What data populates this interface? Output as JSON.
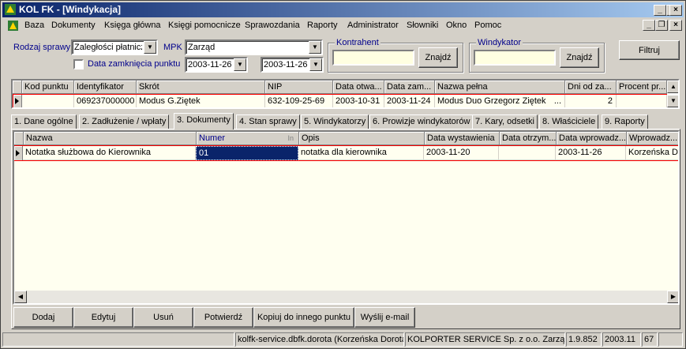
{
  "window": {
    "title": "KOL FK - [Windykacja]",
    "controls": {
      "minimize": "_",
      "maximize": "□",
      "close": "×"
    }
  },
  "menu": {
    "items": [
      "Baza",
      "Dokumenty",
      "Księga główna",
      "Księgi pomocnicze",
      "Sprawozdania",
      "Raporty",
      "Administrator",
      "Słowniki",
      "Okno",
      "Pomoc"
    ],
    "controls": {
      "minimize": "_",
      "restore": "❐",
      "close": "×"
    }
  },
  "filters": {
    "rodzaj_label": "Rodzaj sprawy",
    "rodzaj_value": "Zaległości płatnicz",
    "mpk_label": "MPK",
    "mpk_value": "Zarząd",
    "data_zamkniecia_label": "Data zamknięcia punktu",
    "date_from": "2003-11-26",
    "date_to": "2003-11-26",
    "kontrahent_title": "Kontrahent",
    "kontrahent_button": "Znajdź",
    "windykator_title": "Windykator",
    "windykator_button": "Znajdź",
    "filter_button": "Filtruj"
  },
  "main_table": {
    "columns": [
      "Kod punktu",
      "Identyfikator",
      "Skrót",
      "NIP",
      "Data otwa...",
      "Data zam...",
      "Nazwa pełna",
      "Dni od za...",
      "Procent pr..."
    ],
    "rows": [
      [
        "",
        "069237000000",
        "Modus G.Ziętek",
        "632-109-25-69",
        "2003-10-31",
        "2003-11-24",
        "Modus Duo Grzegorz Ziętek",
        "2",
        ""
      ]
    ],
    "ellipsis": "..."
  },
  "tabs": [
    "1. Dane ogólne",
    "2. Zadłużenie / wpłaty",
    "3. Dokumenty",
    "4. Stan sprawy",
    "5. Windykatorzy",
    "6. Prowizje windykatorów",
    "7. Kary, odsetki",
    "8. Właściciele",
    "9. Raporty"
  ],
  "active_tab": 2,
  "docs_table": {
    "columns": [
      "Nazwa",
      "Numer",
      "Opis",
      "Data wystawienia",
      "Data otrzym...",
      "Data wprowadz...",
      "Wprowadz..."
    ],
    "rows": [
      [
        "Notatka służbowa do Kierownika",
        "01",
        "notatka dla kierownika",
        "2003-11-20",
        "",
        "2003-11-26",
        "Korzeńska Do"
      ]
    ]
  },
  "actions": [
    "Dodaj",
    "Edytuj",
    "Usuń",
    "Potwierdź",
    "Kopiuj do innego punktu",
    "Wyślij e-mail"
  ],
  "statusbar": [
    "",
    "kolfk-service.dbfk.dorota (Korzeńska Dorota)",
    "KOLPORTER SERVICE Sp. z o.o. Zarząd",
    "1.9.852",
    "2003.11",
    "67"
  ],
  "colors": {
    "title_start": "#0a246a",
    "title_end": "#a6caf0",
    "panel": "#d4d0c8",
    "input_yellow": "#ffffe1",
    "row_highlight": "#0a246a",
    "row_border": "#ff0000",
    "grid_bg": "#fffff0"
  }
}
